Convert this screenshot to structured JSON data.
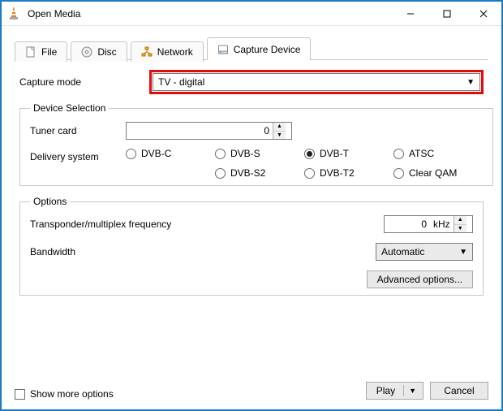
{
  "window": {
    "title": "Open Media"
  },
  "tabs": {
    "file": "File",
    "disc": "Disc",
    "network": "Network",
    "capture": "Capture Device"
  },
  "capture": {
    "mode_label": "Capture mode",
    "mode_value": "TV - digital"
  },
  "device_selection": {
    "legend": "Device Selection",
    "tuner_label": "Tuner card",
    "tuner_value": "0",
    "delivery_label": "Delivery system",
    "radios": {
      "dvbc": "DVB-C",
      "dvbs": "DVB-S",
      "dvbt": "DVB-T",
      "atsc": "ATSC",
      "dvbs2": "DVB-S2",
      "dvbt2": "DVB-T2",
      "clearqam": "Clear QAM"
    }
  },
  "options": {
    "legend": "Options",
    "freq_label": "Transponder/multiplex frequency",
    "freq_value": "0",
    "freq_unit": "kHz",
    "bandwidth_label": "Bandwidth",
    "bandwidth_value": "Automatic",
    "advanced": "Advanced options..."
  },
  "footer": {
    "show_more": "Show more options",
    "play": "Play",
    "cancel": "Cancel"
  }
}
